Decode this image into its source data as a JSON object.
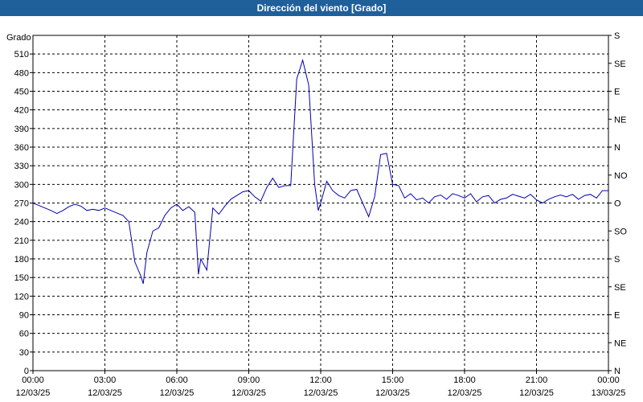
{
  "title": "Dirección del viento [Grado]",
  "chart_data": {
    "type": "line",
    "title": "Dirección del viento [Grado]",
    "ylabel": "Grado",
    "ylim": [
      0,
      540
    ],
    "yticks": [
      0,
      30,
      60,
      90,
      120,
      150,
      180,
      210,
      240,
      270,
      300,
      330,
      360,
      390,
      420,
      450,
      480,
      510
    ],
    "right_axis_labels": [
      "N",
      "NE",
      "E",
      "SE",
      "S",
      "SO",
      "O",
      "NO",
      "N",
      "NE",
      "E",
      "SE",
      "S"
    ],
    "xlim": [
      0,
      24
    ],
    "xticks": [
      {
        "time": "00:00",
        "date": "12/03/25"
      },
      {
        "time": "03:00",
        "date": "12/03/25"
      },
      {
        "time": "06:00",
        "date": "12/03/25"
      },
      {
        "time": "09:00",
        "date": "12/03/25"
      },
      {
        "time": "12:00",
        "date": "12/03/25"
      },
      {
        "time": "15:00",
        "date": "12/03/25"
      },
      {
        "time": "18:00",
        "date": "12/03/25"
      },
      {
        "time": "21:00",
        "date": "12/03/25"
      },
      {
        "time": "00:00",
        "date": "13/03/25"
      }
    ],
    "grid": true,
    "series": [
      {
        "color": "#0000b0",
        "x": [
          0,
          0.25,
          0.5,
          0.75,
          1,
          1.25,
          1.5,
          1.75,
          2,
          2.25,
          2.5,
          2.75,
          3,
          3.25,
          3.5,
          3.75,
          4,
          4.25,
          4.5,
          4.6,
          4.75,
          5,
          5.25,
          5.5,
          5.75,
          6,
          6.25,
          6.5,
          6.75,
          6.9,
          7,
          7.25,
          7.5,
          7.75,
          8,
          8.25,
          8.5,
          8.75,
          9,
          9.25,
          9.5,
          9.75,
          10,
          10.25,
          10.5,
          10.75,
          11,
          11.25,
          11.5,
          11.75,
          11.9,
          12,
          12.25,
          12.5,
          12.75,
          13,
          13.25,
          13.5,
          13.75,
          14,
          14.25,
          14.5,
          14.75,
          15,
          15.25,
          15.5,
          15.75,
          16,
          16.25,
          16.5,
          16.75,
          17,
          17.25,
          17.5,
          17.75,
          18,
          18.25,
          18.5,
          18.75,
          19,
          19.25,
          19.5,
          19.75,
          20,
          20.25,
          20.5,
          20.75,
          21,
          21.25,
          21.5,
          21.75,
          22,
          22.25,
          22.5,
          22.75,
          23,
          23.25,
          23.5,
          23.75,
          24
        ],
        "y": [
          270,
          266,
          262,
          258,
          253,
          258,
          264,
          268,
          265,
          258,
          260,
          258,
          262,
          258,
          254,
          250,
          240,
          175,
          152,
          140,
          190,
          225,
          230,
          250,
          262,
          268,
          258,
          264,
          255,
          155,
          180,
          162,
          262,
          252,
          265,
          276,
          282,
          288,
          290,
          280,
          273,
          295,
          310,
          295,
          298,
          298,
          470,
          500,
          460,
          300,
          258,
          270,
          305,
          290,
          282,
          278,
          290,
          292,
          270,
          248,
          280,
          348,
          350,
          300,
          298,
          278,
          285,
          275,
          278,
          270,
          280,
          283,
          276,
          285,
          282,
          278,
          285,
          272,
          280,
          282,
          270,
          276,
          278,
          284,
          281,
          278,
          284,
          275,
          270,
          276,
          280,
          283,
          280,
          284,
          276,
          282,
          284,
          278,
          290,
          290
        ]
      }
    ]
  }
}
